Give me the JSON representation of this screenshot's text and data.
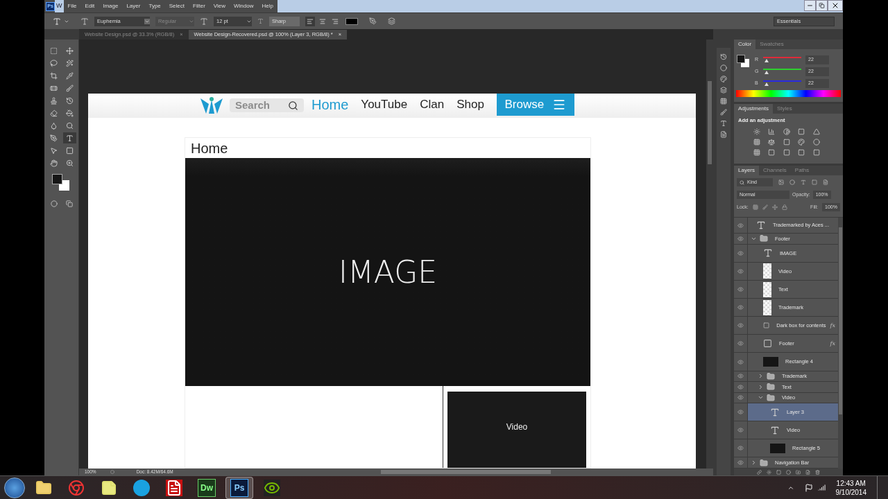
{
  "window": {
    "app_icon": "Ps",
    "title": "W"
  },
  "menu": [
    "File",
    "Edit",
    "Image",
    "Layer",
    "Type",
    "Select",
    "Filter",
    "View",
    "Window",
    "Help"
  ],
  "options": {
    "font": "Euphemia",
    "style": "Regular",
    "size": "12 pt",
    "antialias": "Sharp",
    "workspace": "Essentials",
    "align": [
      {
        "selected": true
      },
      {
        "selected": false
      },
      {
        "selected": false
      }
    ]
  },
  "doc_tabs": [
    {
      "label": "Website Design.psd @ 33.3% (RGB/8)",
      "close": "×",
      "selected": false
    },
    {
      "label": "Website Design-Recovered.psd @ 100% (Layer 3, RGB/8) *",
      "close": "×",
      "selected": true
    }
  ],
  "tools": [
    {
      "selected": false
    },
    {
      "selected": false
    },
    {
      "selected": false
    },
    {
      "selected": false
    },
    {
      "selected": false
    },
    {
      "selected": false
    },
    {
      "selected": false
    },
    {
      "selected": false
    },
    {
      "selected": false
    },
    {
      "selected": false
    },
    {
      "selected": false
    },
    {
      "selected": false
    },
    {
      "selected": false
    },
    {
      "selected": false
    },
    {
      "selected": false
    },
    {
      "selected": true
    },
    {
      "selected": false
    },
    {
      "selected": false
    },
    {
      "selected": false
    },
    {
      "selected": false
    }
  ],
  "canvas": {
    "search_placeholder": "Search",
    "links": [
      {
        "label": "Home",
        "selected": true
      },
      {
        "label": "YouTube",
        "selected": false
      },
      {
        "label": "Clan",
        "selected": false
      },
      {
        "label": "Shop",
        "selected": false
      }
    ],
    "browse": "Browse",
    "heading": "Home",
    "image_label": "IMAGE",
    "video_label": "Video"
  },
  "status": {
    "zoom": "100%",
    "doc": "Doc: 8.42M/64.6M"
  },
  "color_panel": {
    "tabs": [
      {
        "label": "Color",
        "selected": true
      },
      {
        "label": "Swatches",
        "selected": false
      }
    ],
    "channels": [
      {
        "name": "R",
        "value": "22",
        "color": "#e02a3a",
        "level": 0.086
      },
      {
        "name": "G",
        "value": "22",
        "color": "#2ed02e",
        "level": 0.086
      },
      {
        "name": "B",
        "value": "22",
        "color": "#2a2ae0",
        "level": 0.086
      }
    ]
  },
  "adjustments": {
    "tabs": [
      {
        "label": "Adjustments",
        "selected": true
      },
      {
        "label": "Styles",
        "selected": false
      }
    ],
    "heading": "Add an adjustment"
  },
  "layers_panel": {
    "tabs": [
      {
        "label": "Layers",
        "selected": true
      },
      {
        "label": "Channels",
        "selected": false
      },
      {
        "label": "Paths",
        "selected": false
      }
    ],
    "filter": "Kind",
    "blend": "Normal",
    "opacity_label": "Opacity:",
    "opacity": "100%",
    "lock_label": "Lock:",
    "fill_label": "Fill:",
    "fill": "100%",
    "layers": [
      {
        "kind": "text",
        "name": "Trademarked by Aces ...",
        "selected": false
      },
      {
        "kind": "group",
        "name": "Footer",
        "expanded": true,
        "selected": false,
        "children": [
          {
            "kind": "text",
            "name": "IMAGE",
            "selected": false
          },
          {
            "kind": "pixel",
            "name": "Video",
            "selected": false
          },
          {
            "kind": "pixel",
            "name": "Text",
            "selected": false
          },
          {
            "kind": "pixel",
            "name": "Trademark",
            "selected": false
          },
          {
            "kind": "shape",
            "name": "Dark box for contents",
            "effects": "fx",
            "selected": false
          },
          {
            "kind": "shape",
            "name": "Footer",
            "effects": "fx",
            "selected": false
          },
          {
            "kind": "dark",
            "name": "Rectangle 4",
            "selected": false
          },
          {
            "kind": "group",
            "name": "Trademark",
            "expanded": false,
            "selected": false
          },
          {
            "kind": "group",
            "name": "Text",
            "expanded": false,
            "selected": false
          },
          {
            "kind": "group",
            "name": "Video",
            "expanded": true,
            "selected": false,
            "children": [
              {
                "kind": "text",
                "name": "Layer 3",
                "selected": true
              },
              {
                "kind": "text",
                "name": "Video",
                "selected": false
              },
              {
                "kind": "dark",
                "name": "Rectangle 5",
                "selected": false
              }
            ]
          }
        ]
      },
      {
        "kind": "group",
        "name": "Navigation Bar",
        "expanded": false,
        "selected": false
      }
    ]
  },
  "taskbar": {
    "apps": [
      {
        "kind": "folder",
        "selected": false
      },
      {
        "kind": "chrome",
        "selected": false
      },
      {
        "kind": "notes",
        "selected": false
      },
      {
        "kind": "skype",
        "selected": false
      },
      {
        "kind": "acrobat",
        "selected": false
      },
      {
        "kind": "dreamweaver",
        "label": "Dw",
        "selected": false
      },
      {
        "kind": "photoshop",
        "label": "Ps",
        "selected": true
      },
      {
        "kind": "nvidia",
        "selected": false
      }
    ],
    "time": "12:43 AM",
    "date": "9/10/2014"
  }
}
